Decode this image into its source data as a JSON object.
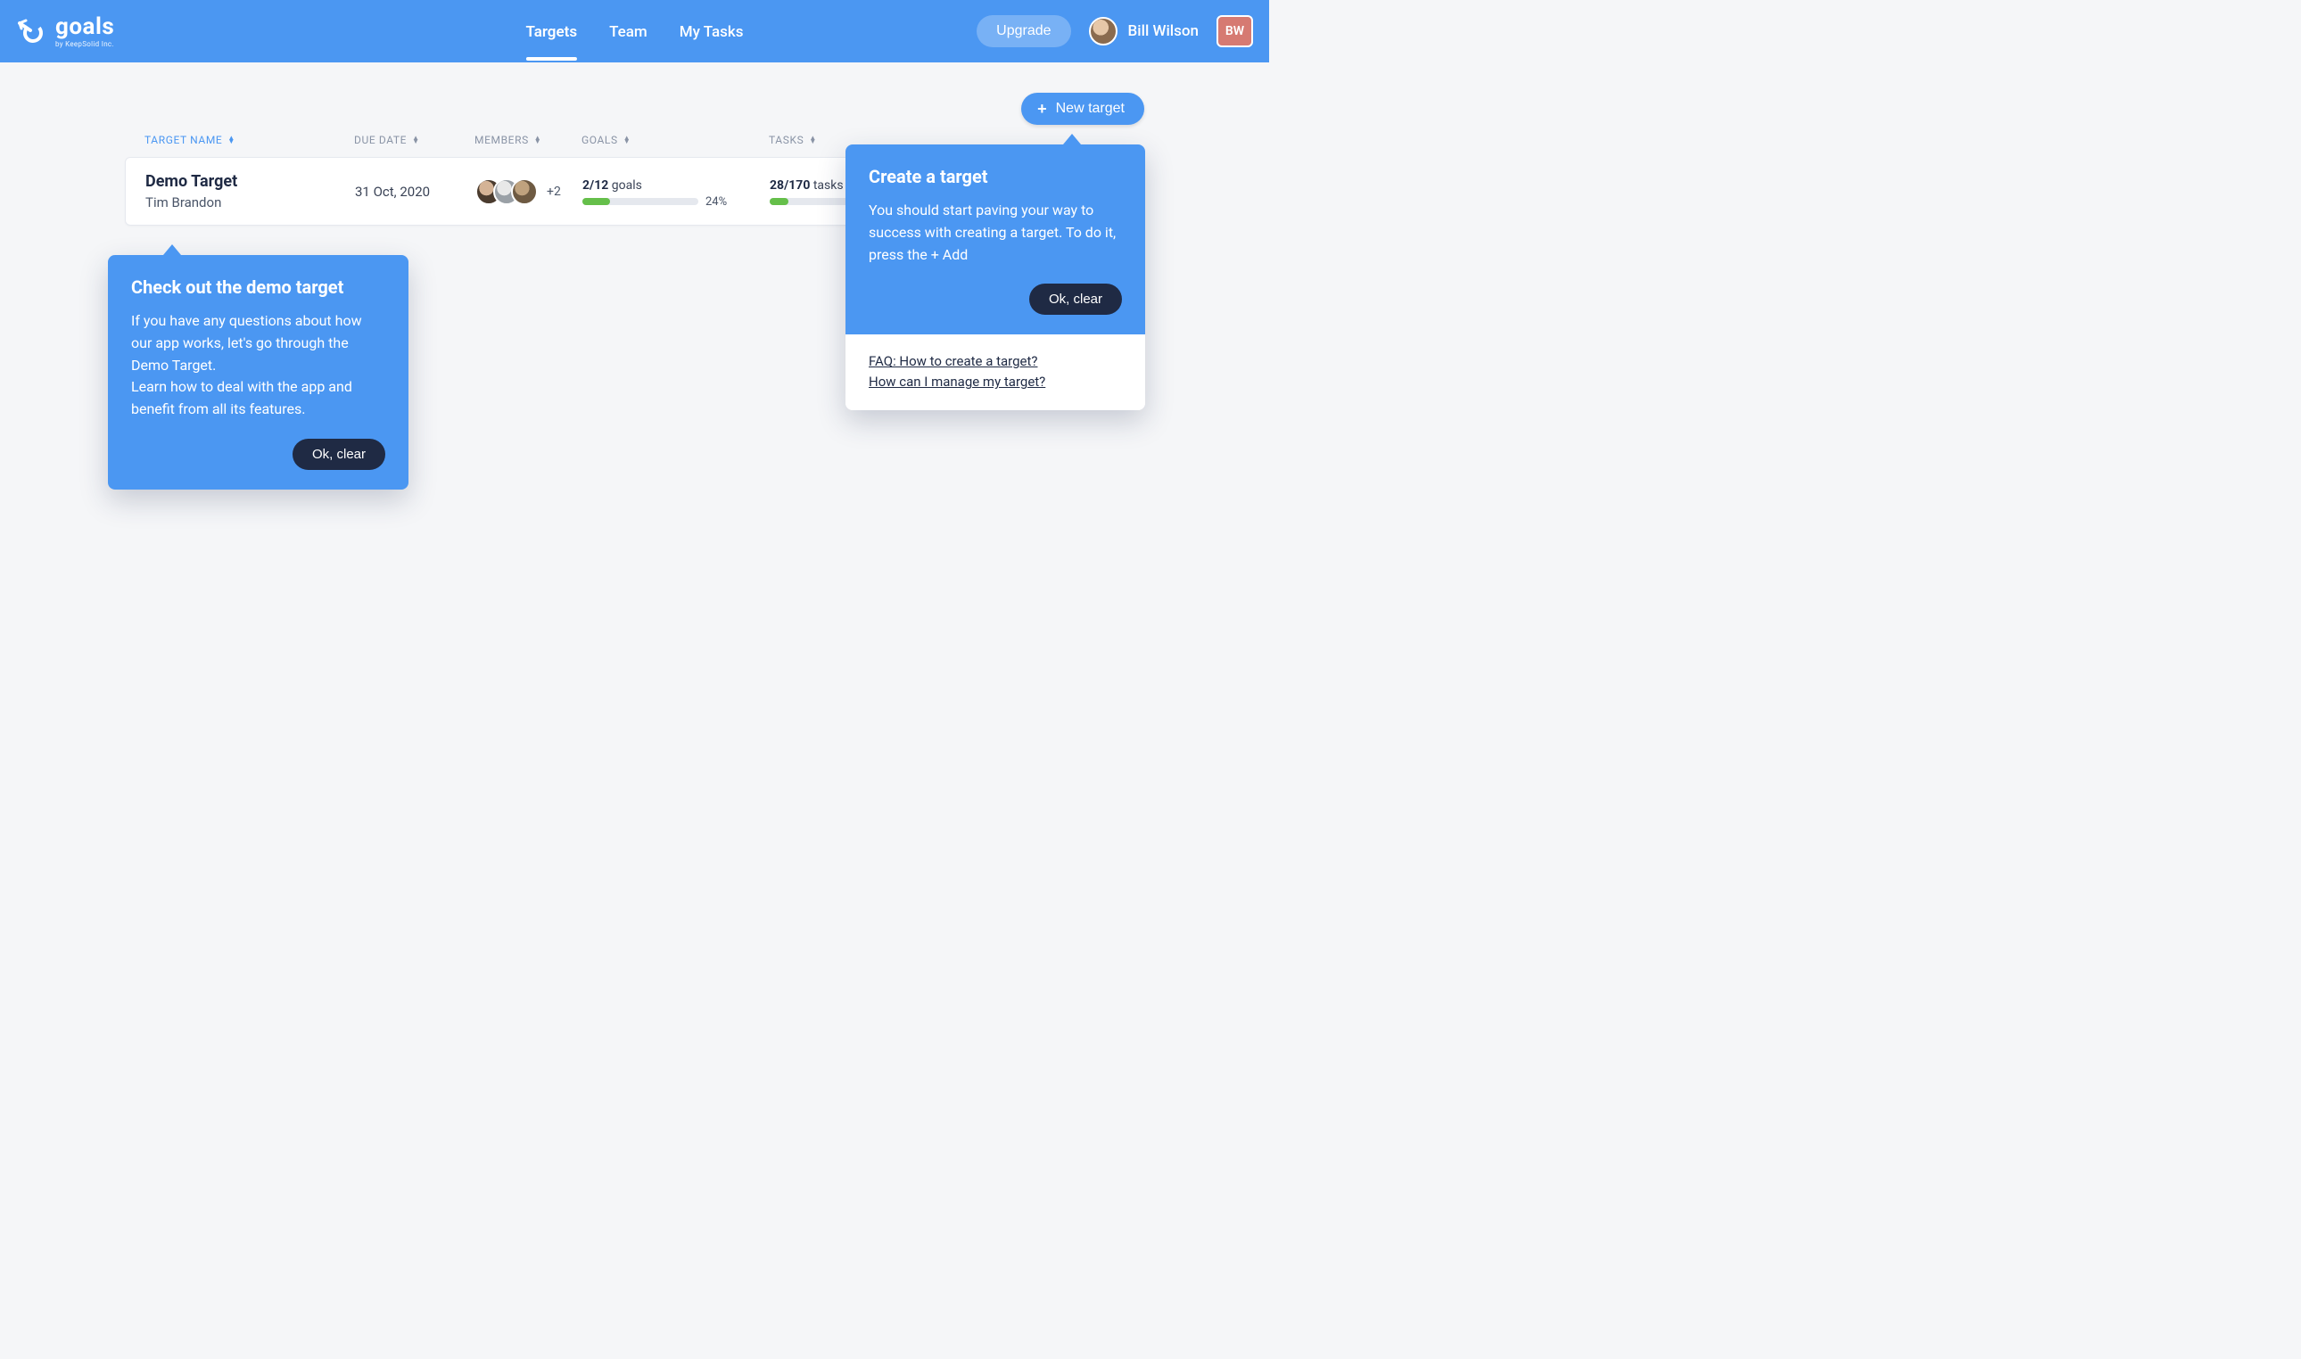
{
  "header": {
    "brand": "goals",
    "brand_sub": "by KeepSolid Inc.",
    "nav": [
      "Targets",
      "Team",
      "My Tasks"
    ],
    "active_nav_index": 0,
    "upgrade_label": "Upgrade",
    "user_name": "Bill Wilson",
    "user_initials": "BW"
  },
  "toolbar": {
    "new_target_label": "New target"
  },
  "columns": {
    "target_name": "TARGET NAME",
    "due_date": "DUE DATE",
    "members": "MEMBERS",
    "goals": "GOALS",
    "tasks": "TASKS"
  },
  "row": {
    "name": "Demo Target",
    "owner": "Tim Brandon",
    "due_date": "31 Oct, 2020",
    "members_extra": "+2",
    "goals_count": "2/12",
    "goals_word": " goals",
    "goals_pct_text": "24%",
    "goals_pct": 24,
    "tasks_count": "28/170",
    "tasks_word": " tasks",
    "tasks_pct": 16
  },
  "tip_demo": {
    "title": "Check out the demo target",
    "body1": "If you have any questions about how our app works, let's go through the Demo Target.",
    "body2": "Learn how to deal with the app and benefit from all its features.",
    "ok": "Ok, clear"
  },
  "tip_create": {
    "title": "Create a target",
    "body": "You should start paving your way to success with creating a target. To do it, press the + Add",
    "ok": "Ok, clear",
    "faq1": "FAQ: How to create a target?",
    "faq2": "How can I manage my target?"
  }
}
